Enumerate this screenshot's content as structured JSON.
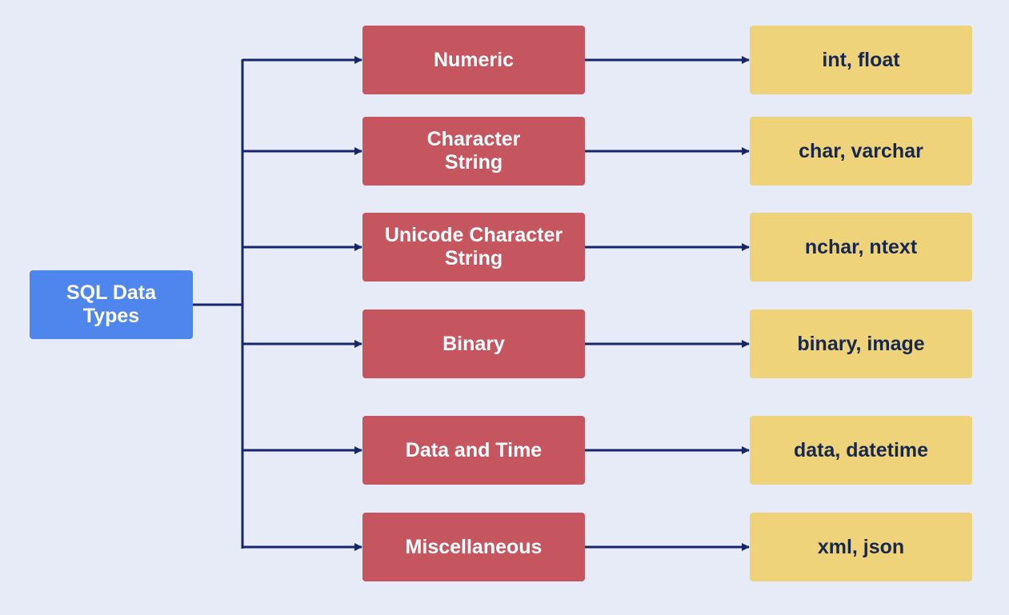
{
  "colors": {
    "background": "#e7ebf7",
    "root_fill": "#4f86ee",
    "category_fill": "#c55660",
    "value_fill": "#efd37a",
    "connector": "#16266b",
    "value_text": "#17284f"
  },
  "root": {
    "label": "SQL Data Types"
  },
  "categories": [
    {
      "label": "Numeric",
      "examples": "int, float"
    },
    {
      "label": "Character String",
      "examples": "char, varchar"
    },
    {
      "label": "Unicode Character String",
      "examples": "nchar, ntext"
    },
    {
      "label": "Binary",
      "examples": "binary, image"
    },
    {
      "label": "Data and Time",
      "examples": "data, datetime"
    },
    {
      "label": "Miscellaneous",
      "examples": "xml, json"
    }
  ]
}
